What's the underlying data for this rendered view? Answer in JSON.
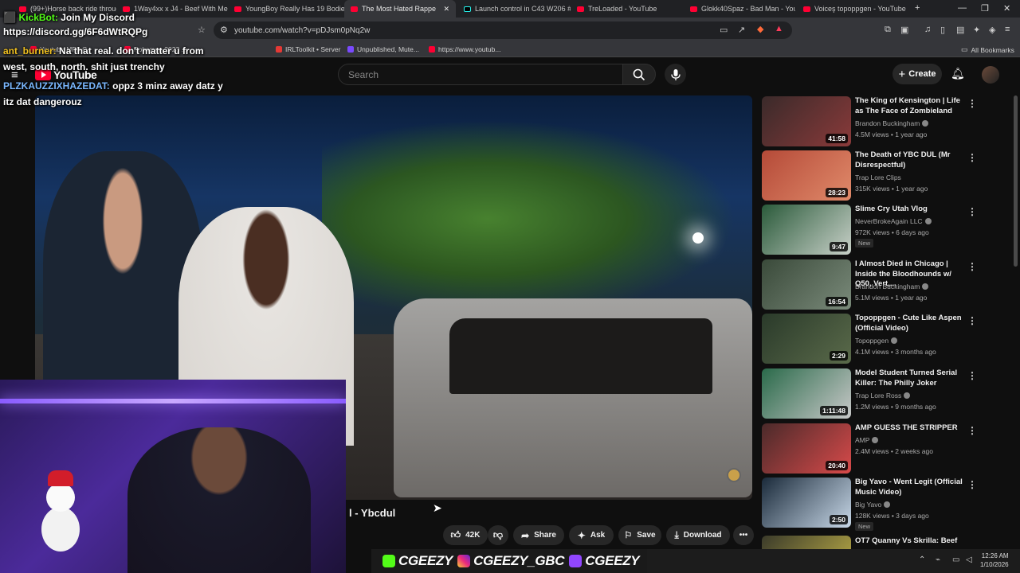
{
  "tabs": [
    {
      "title": "(99+)Horse back ride through",
      "icon": "youtube"
    },
    {
      "title": "1Way4xx x J4 - Beef With Me",
      "icon": "youtube"
    },
    {
      "title": "YoungBoy Really Has 19 Bodie",
      "icon": "youtube"
    },
    {
      "title": "The Most Hated Rappe",
      "icon": "youtube",
      "active": true
    },
    {
      "title": "Launch control in C43 W206 #",
      "icon": "tiktok"
    },
    {
      "title": "TreLoaded - YouTube",
      "icon": "youtube"
    },
    {
      "title": "Glokk40Spaz - Bad Man - YouT",
      "icon": "youtube"
    },
    {
      "title": "Voiceş topoppgen - YouTube",
      "icon": "youtube"
    }
  ],
  "address_bar": {
    "url": "youtube.com/watch?v=pDJsm0pNq2w"
  },
  "bookmarks": [
    {
      "label": "IRLToolkit • Server"
    },
    {
      "label": "Unpublished, Mute..."
    },
    {
      "label": "https://www.youtub..."
    },
    {
      "label": "All Bookmarks"
    }
  ],
  "bookmarks_partial": [
    "Youtube MP3 C",
    "Pokemon 2023 ..."
  ],
  "youtube": {
    "logo_text": "YouTube",
    "search_placeholder": "Search",
    "create_label": "Create"
  },
  "chat": [
    {
      "name": "KickBot:",
      "text": "Join My Discord",
      "name_color": "#53fc18"
    },
    {
      "name": "",
      "text": "https://discord.gg/6F6dWtRQPg"
    },
    {
      "name": "ant_burner:",
      "text": "Na that real. don't matter u from"
    },
    {
      "name": "",
      "text": "west, south, north. shit just trenchy"
    },
    {
      "name": "PLZKAUZZIXHAZEDAT:",
      "text": "oppz 3 minz away datz y"
    },
    {
      "name": "",
      "text": "itz dat dangerouz"
    }
  ],
  "video": {
    "title_fragment": "l - Ybcdul",
    "likes": "42K",
    "share_label": "Share",
    "ask_label": "Ask",
    "save_label": "Save",
    "download_label": "Download"
  },
  "recommendations": [
    {
      "title": "The King of Kensington | Life as The Face of Zombieland",
      "channel": "Brandon Buckingham",
      "verified": true,
      "views": "4.5M views • 1 year ago",
      "duration": "41:58",
      "new": false,
      "thumb_colors": [
        "#3a2a2a",
        "#8a3a3a"
      ]
    },
    {
      "title": "The Death of YBC DUL (Mr Disrespectful)",
      "channel": "Trap Lore Clips",
      "verified": false,
      "views": "315K views • 1 year ago",
      "duration": "28:23",
      "new": false,
      "thumb_colors": [
        "#b54a38",
        "#e08a6a"
      ]
    },
    {
      "title": "Slime Cry Utah Vlog",
      "channel": "NeverBrokeAgain LLC",
      "verified": true,
      "views": "972K views • 6 days ago",
      "duration": "9:47",
      "new": true,
      "thumb_colors": [
        "#2a5a3a",
        "#c8d0c8"
      ]
    },
    {
      "title": "I Almost Died in Chicago | Inside the Bloodhounds w/ Q50, Vert,...",
      "channel": "Brandon Buckingham",
      "verified": true,
      "views": "5.1M views • 1 year ago",
      "duration": "16:54",
      "new": false,
      "thumb_colors": [
        "#3a4a3a",
        "#7a8a7a"
      ]
    },
    {
      "title": "Topoppgen - Cute Like Aspen (Official Video)",
      "channel": "Topoppgen",
      "verified": true,
      "views": "4.1M views • 3 months ago",
      "duration": "2:29",
      "new": false,
      "thumb_colors": [
        "#2a3a2a",
        "#5a6a4a"
      ]
    },
    {
      "title": "Model Student Turned Serial Killer: The Philly Joker",
      "channel": "Trap Lore Ross",
      "verified": true,
      "views": "1.2M views • 9 months ago",
      "duration": "1:11:48",
      "new": false,
      "thumb_colors": [
        "#2a6a4a",
        "#c8c8c8"
      ]
    },
    {
      "title": "AMP GUESS THE STRIPPER",
      "channel": "AMP",
      "verified": true,
      "views": "2.4M views • 2 weeks ago",
      "duration": "20:40",
      "new": false,
      "thumb_colors": [
        "#4a2a2a",
        "#d84a4a"
      ]
    },
    {
      "title": "Big Yavo - Went Legit (Official Music Video)",
      "channel": "Big Yavo",
      "verified": true,
      "views": "128K views • 3 days ago",
      "duration": "2:50",
      "new": true,
      "thumb_colors": [
        "#1a2a3a",
        "#c8d8e8"
      ]
    },
    {
      "title": "OT7 Quanny Vs Skrilla: Beef",
      "channel": "",
      "verified": false,
      "views": "",
      "duration": "",
      "new": false,
      "thumb_colors": [
        "#3a3a2a",
        "#c8b84a"
      ]
    }
  ],
  "new_badge": "New",
  "stream_overlay": {
    "handles": [
      "CGEEZY",
      "CGEEZY_GBC",
      "CGEEZY"
    ]
  },
  "taskbar": {
    "time": "12:26 AM",
    "date": "1/10/2026"
  }
}
